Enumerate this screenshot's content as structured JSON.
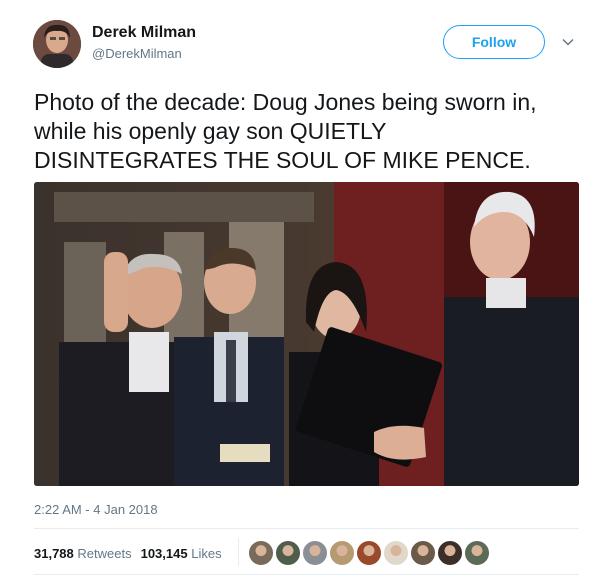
{
  "author": {
    "name": "Derek Milman",
    "handle": "@DerekMilman"
  },
  "follow_button": {
    "label": "Follow"
  },
  "tweet": {
    "text": "Photo of the decade: Doug Jones being sworn in, while his openly gay son QUIETLY DISINTEGRATES THE SOUL OF MIKE PENCE.",
    "timestamp": "2:22 AM - 4 Jan 2018"
  },
  "stats": {
    "retweets_count": "31,788",
    "retweets_label": "Retweets",
    "likes_count": "103,145",
    "likes_label": "Likes"
  },
  "likers": [
    {
      "color": "#7a6a5c"
    },
    {
      "color": "#4f5d4a"
    },
    {
      "color": "#8a8f96"
    },
    {
      "color": "#b59a72"
    },
    {
      "color": "#9a4a2c"
    },
    {
      "color": "#e0d8c8"
    },
    {
      "color": "#6b5a48"
    },
    {
      "color": "#3c2f28"
    },
    {
      "color": "#5c6a58"
    }
  ],
  "colors": {
    "accent": "#1da1f2",
    "text": "#14171a",
    "muted": "#657786"
  }
}
